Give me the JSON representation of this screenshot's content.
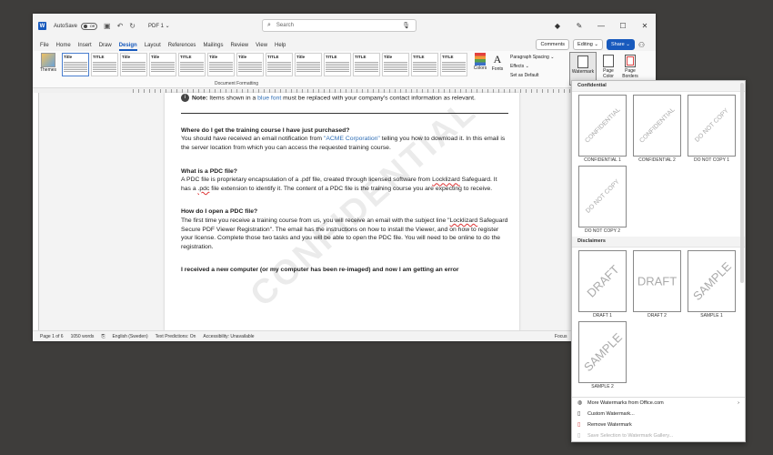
{
  "titlebar": {
    "app_letter": "W",
    "autosave_label": "AutoSave",
    "autosave_state": "Off",
    "doc_name": "PDF 1 ⌄",
    "search_placeholder": "Search"
  },
  "menu": {
    "tabs": [
      "File",
      "Home",
      "Insert",
      "Draw",
      "Design",
      "Layout",
      "References",
      "Mailings",
      "Review",
      "View",
      "Help"
    ],
    "active_tab": "Design",
    "comments_label": "Comments",
    "editing_label": "Editing ⌄",
    "share_label": "Share ⌄"
  },
  "ribbon": {
    "themes_label": "Themes",
    "style_thumbs": [
      "Title",
      "TITLE",
      "Title",
      "Title",
      "TITLE",
      "Title",
      "Title",
      "TITLE",
      "Title",
      "TITLE",
      "TITLE",
      "Title",
      "TITLE",
      "TITLE"
    ],
    "group_label": "Document Formatting",
    "colors_label": "Colors",
    "fonts_label": "Fonts",
    "paragraph_spacing": "Paragraph Spacing ⌄",
    "effects": "Effects ⌄",
    "set_default": "Set as Default",
    "watermark_label": "Watermark",
    "page_color_label": "Page Color",
    "page_borders_label": "Page Borders"
  },
  "document": {
    "note_bold": "Note:",
    "note_text_1": " Items shown in a ",
    "note_blue": "blue font",
    "note_text_2": " must be replaced with your company's contact information as relevant.",
    "watermark_text": "CONFIDENTIAL",
    "q1": "Where do I get the training course I have just purchased?",
    "a1_1": "You should have received an email notification from ",
    "a1_blue": "\"ACME Corporation\"",
    "a1_2": " telling you how to download it.  In this email is the server location from which you can access the requested training course.",
    "q2": "What is a PDC file?",
    "a2_1": "A PDC file is proprietary encapsulation of a .pdf file, created through licensed software from ",
    "a2_lock": "Locklizard",
    "a2_2": " Safeguard. It has a ",
    "a2_pdc": ".pdc",
    "a2_3": " file extension to identify it.  The content of a PDC file is the training course you are expecting to receive.",
    "q3": "How do I open a PDC file?",
    "a3_1": " The first time you receive a training course from us, you will receive an email with the subject line \"",
    "a3_lock": "Locklizard",
    "a3_2": " Safeguard Secure PDF Viewer Registration\".  The email has the instructions on how to install the Viewer, and on how to register your license.  Complete those two tasks and you will be able to open the PDC file. You will need to be online to do the registration.",
    "q4": "I received a new computer (or my computer has been re-imaged) and now I am getting an error"
  },
  "status": {
    "page": "Page 1 of 6",
    "words": "1050 words",
    "language": "English (Sweden)",
    "predictions": "Text Predictions: On",
    "accessibility": "Accessibility: Unavailable",
    "focus": "Focus"
  },
  "watermark_menu": {
    "section_confidential": "Confidential",
    "confidential_items": [
      {
        "label": "CONFIDENTIAL 1",
        "text": "CONFIDENTIAL"
      },
      {
        "label": "CONFIDENTIAL 2",
        "text": "CONFIDENTIAL"
      },
      {
        "label": "DO NOT COPY 1",
        "text": "DO NOT COPY"
      },
      {
        "label": "DO NOT COPY 2",
        "text": "DO NOT COPY"
      }
    ],
    "section_disclaimers": "Disclaimers",
    "disclaimer_items": [
      {
        "label": "DRAFT 1",
        "text": "DRAFT"
      },
      {
        "label": "DRAFT 2",
        "text": "DRAFT"
      },
      {
        "label": "SAMPLE 1",
        "text": "SAMPLE"
      },
      {
        "label": "SAMPLE 2",
        "text": "SAMPLE"
      }
    ],
    "more": "More Watermarks from Office.com",
    "custom": "Custom Watermark...",
    "remove": "Remove Watermark",
    "save_selection": "Save Selection to Watermark Gallery..."
  }
}
